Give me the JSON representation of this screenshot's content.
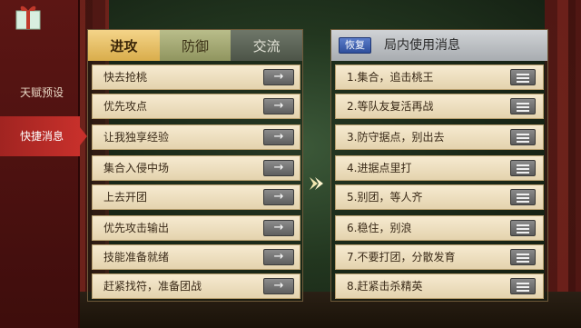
{
  "sidenav": {
    "items": [
      {
        "label": "天赋预设"
      },
      {
        "label": "快捷消息"
      }
    ]
  },
  "left_panel": {
    "tabs": [
      {
        "label": "进攻"
      },
      {
        "label": "防御"
      },
      {
        "label": "交流"
      }
    ],
    "send_glyph": "→",
    "messages": [
      {
        "label": "快去抢桃"
      },
      {
        "label": "优先攻点"
      },
      {
        "label": "让我独享经验"
      },
      {
        "label": "集合入侵中场"
      },
      {
        "label": "上去开团"
      },
      {
        "label": "优先攻击输出"
      },
      {
        "label": "技能准备就绪"
      },
      {
        "label": "赶紧找符，准备团战"
      }
    ]
  },
  "right_panel": {
    "reset_label": "恢复",
    "title": "局内使用消息",
    "messages": [
      {
        "label": "1.集合，追击桃王"
      },
      {
        "label": "2.等队友复活再战"
      },
      {
        "label": "3.防守据点，别出去"
      },
      {
        "label": "4.进据点里打"
      },
      {
        "label": "5.别团，等人齐"
      },
      {
        "label": "6.稳住，别浪"
      },
      {
        "label": "7.不要打团，分散发育"
      },
      {
        "label": "8.赶紧击杀精英"
      }
    ]
  },
  "colors": {
    "active_nav": "#c7302b",
    "tab_attack": "#d9ad4b",
    "reset_button": "#2f4f9c"
  }
}
